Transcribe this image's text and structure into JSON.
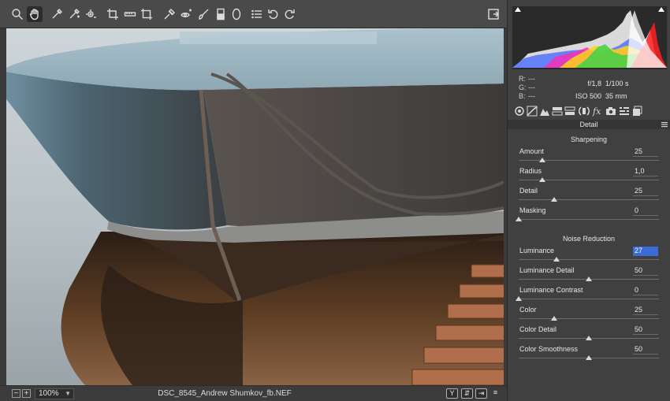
{
  "toolbar": {
    "tools": [
      {
        "name": "zoom-icon",
        "active": false
      },
      {
        "name": "hand-icon",
        "active": true
      },
      {
        "name": "white-balance-icon",
        "active": false
      },
      {
        "name": "color-sampler-icon",
        "active": false
      },
      {
        "name": "targeted-adjustment-icon",
        "active": false
      },
      {
        "name": "crop-icon",
        "active": false
      },
      {
        "name": "straighten-icon",
        "active": false
      },
      {
        "name": "transform-icon",
        "active": false
      },
      {
        "name": "spot-removal-icon",
        "active": false
      },
      {
        "name": "red-eye-icon",
        "active": false
      },
      {
        "name": "adjustment-brush-icon",
        "active": false
      },
      {
        "name": "graduated-filter-icon",
        "active": false
      },
      {
        "name": "radial-filter-icon",
        "active": false
      },
      {
        "name": "preferences-icon",
        "active": false
      },
      {
        "name": "rotate-ccw-icon",
        "active": false
      },
      {
        "name": "rotate-cw-icon",
        "active": false
      }
    ],
    "fullscreen_icon": "fullscreen-toggle-icon"
  },
  "status": {
    "zoom_out": "−",
    "zoom_in": "+",
    "zoom_level": "100%",
    "filename": "DSC_8545_Andrew Shumkov_fb.NEF",
    "before_after_label": "Y"
  },
  "readout": {
    "r_label": "R:",
    "r_value": "---",
    "g_label": "G:",
    "g_value": "---",
    "b_label": "B:",
    "b_value": "---",
    "aperture": "f/1,8",
    "shutter": "1/100 s",
    "iso": "ISO 500",
    "focal": "35 mm"
  },
  "panel_tabs": [
    "basic-icon",
    "tone-curve-icon",
    "detail-icon",
    "hsl-icon",
    "split-toning-icon",
    "lens-corrections-icon",
    "effects-icon",
    "camera-calibration-icon",
    "presets-icon",
    "snapshots-icon"
  ],
  "section": {
    "title": "Detail",
    "sharpening_title": "Sharpening",
    "noise_title": "Noise Reduction",
    "sharpening": [
      {
        "label": "Amount",
        "value": "25",
        "fraction": 0.17
      },
      {
        "label": "Radius",
        "value": "1,0",
        "fraction": 0.17
      },
      {
        "label": "Detail",
        "value": "25",
        "fraction": 0.25
      },
      {
        "label": "Masking",
        "value": "0",
        "fraction": 0.0
      }
    ],
    "noise": [
      {
        "label": "Luminance",
        "value": "27",
        "fraction": 0.27,
        "selected": true
      },
      {
        "label": "Luminance Detail",
        "value": "50",
        "fraction": 0.5
      },
      {
        "label": "Luminance Contrast",
        "value": "0",
        "fraction": 0.0
      },
      {
        "label": "Color",
        "value": "25",
        "fraction": 0.25
      },
      {
        "label": "Color Detail",
        "value": "50",
        "fraction": 0.5
      },
      {
        "label": "Color Smoothness",
        "value": "50",
        "fraction": 0.5
      }
    ]
  },
  "colors": {
    "panel_bg": "#404040",
    "accent_selection": "#3b6bd6",
    "toolbar_bg": "#4a4a4a"
  }
}
